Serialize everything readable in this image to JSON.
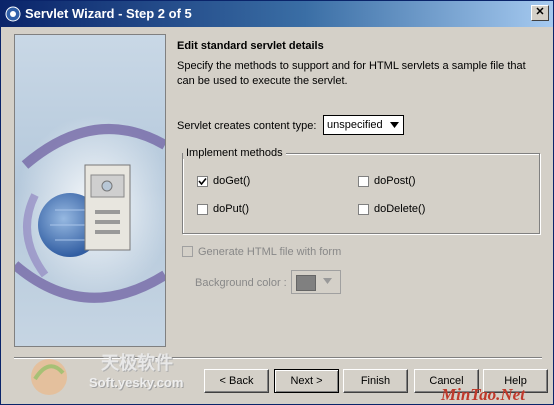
{
  "window": {
    "title": "Servlet Wizard - Step 2 of 5",
    "close_label": "✕"
  },
  "content": {
    "heading": "Edit standard servlet details",
    "description": "Specify the methods to support and for HTML servlets a sample file that can be used to execute the servlet.",
    "content_type_label": "Servlet creates content type:",
    "content_type_value": "unspecified"
  },
  "methods": {
    "legend": "Implement methods",
    "items": [
      {
        "label": "doGet()",
        "checked": true
      },
      {
        "label": "doPost()",
        "checked": false
      },
      {
        "label": "doPut()",
        "checked": false
      },
      {
        "label": "doDelete()",
        "checked": false
      }
    ]
  },
  "html_form": {
    "generate_label": "Generate HTML file with form",
    "background_label": "Background color :",
    "background_color": "#808080",
    "enabled": false
  },
  "buttons": {
    "back": "< Back",
    "next": "Next >",
    "finish": "Finish",
    "cancel": "Cancel",
    "help": "Help"
  },
  "watermarks": {
    "chinese": "天极软件",
    "site": "Soft.yesky.com",
    "corner": "MinTao.Net"
  },
  "colors": {
    "title_start": "#0a246a",
    "title_end": "#a6caf0",
    "dialog": "#d4d0c8",
    "disabled_text": "#888888"
  }
}
